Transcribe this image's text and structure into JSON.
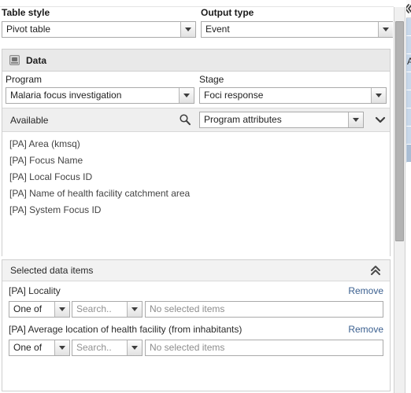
{
  "toprow": {
    "table_style": {
      "label": "Table style",
      "value": "Pivot table"
    },
    "output_type": {
      "label": "Output type",
      "value": "Event"
    }
  },
  "data_panel": {
    "title": "Data",
    "icon": "data-table-icon",
    "program": {
      "label": "Program",
      "value": "Malaria focus investigation"
    },
    "stage": {
      "label": "Stage",
      "value": "Foci response"
    },
    "available": {
      "label": "Available",
      "search_icon": "magnifier-icon",
      "filter_value": "Program attributes",
      "expand_icon": "chevron-down-icon",
      "items": [
        "[PA] Area (kmsq)",
        "[PA] Focus Name",
        "[PA] Local Focus ID",
        "[PA] Name of health facility catchment area",
        "[PA] System Focus ID"
      ]
    }
  },
  "selected_panel": {
    "title": "Selected data items",
    "collapse_icon": "chevron-double-up-icon",
    "rows": [
      {
        "name": "[PA] Locality",
        "remove_label": "Remove",
        "operator": "One of",
        "search_placeholder": "Search..",
        "selected_items_text": "No selected items"
      },
      {
        "name": "[PA] Average location of health facility (from inhabitants)",
        "remove_label": "Remove",
        "operator": "One of",
        "search_placeholder": "Search..",
        "selected_items_text": "No selected items"
      }
    ]
  },
  "right_peek": {
    "collapse_icon": "chevron-double-left-icon",
    "cell_letter": "A"
  },
  "colors": {
    "link": "#3a5f8f",
    "panel_header_bg": "#e9e9e9",
    "section_header_bg": "#f2f2f2",
    "available_bar_bg": "#efefef",
    "border": "#cfcfcf",
    "peek_cell": "#c8d8ea"
  }
}
